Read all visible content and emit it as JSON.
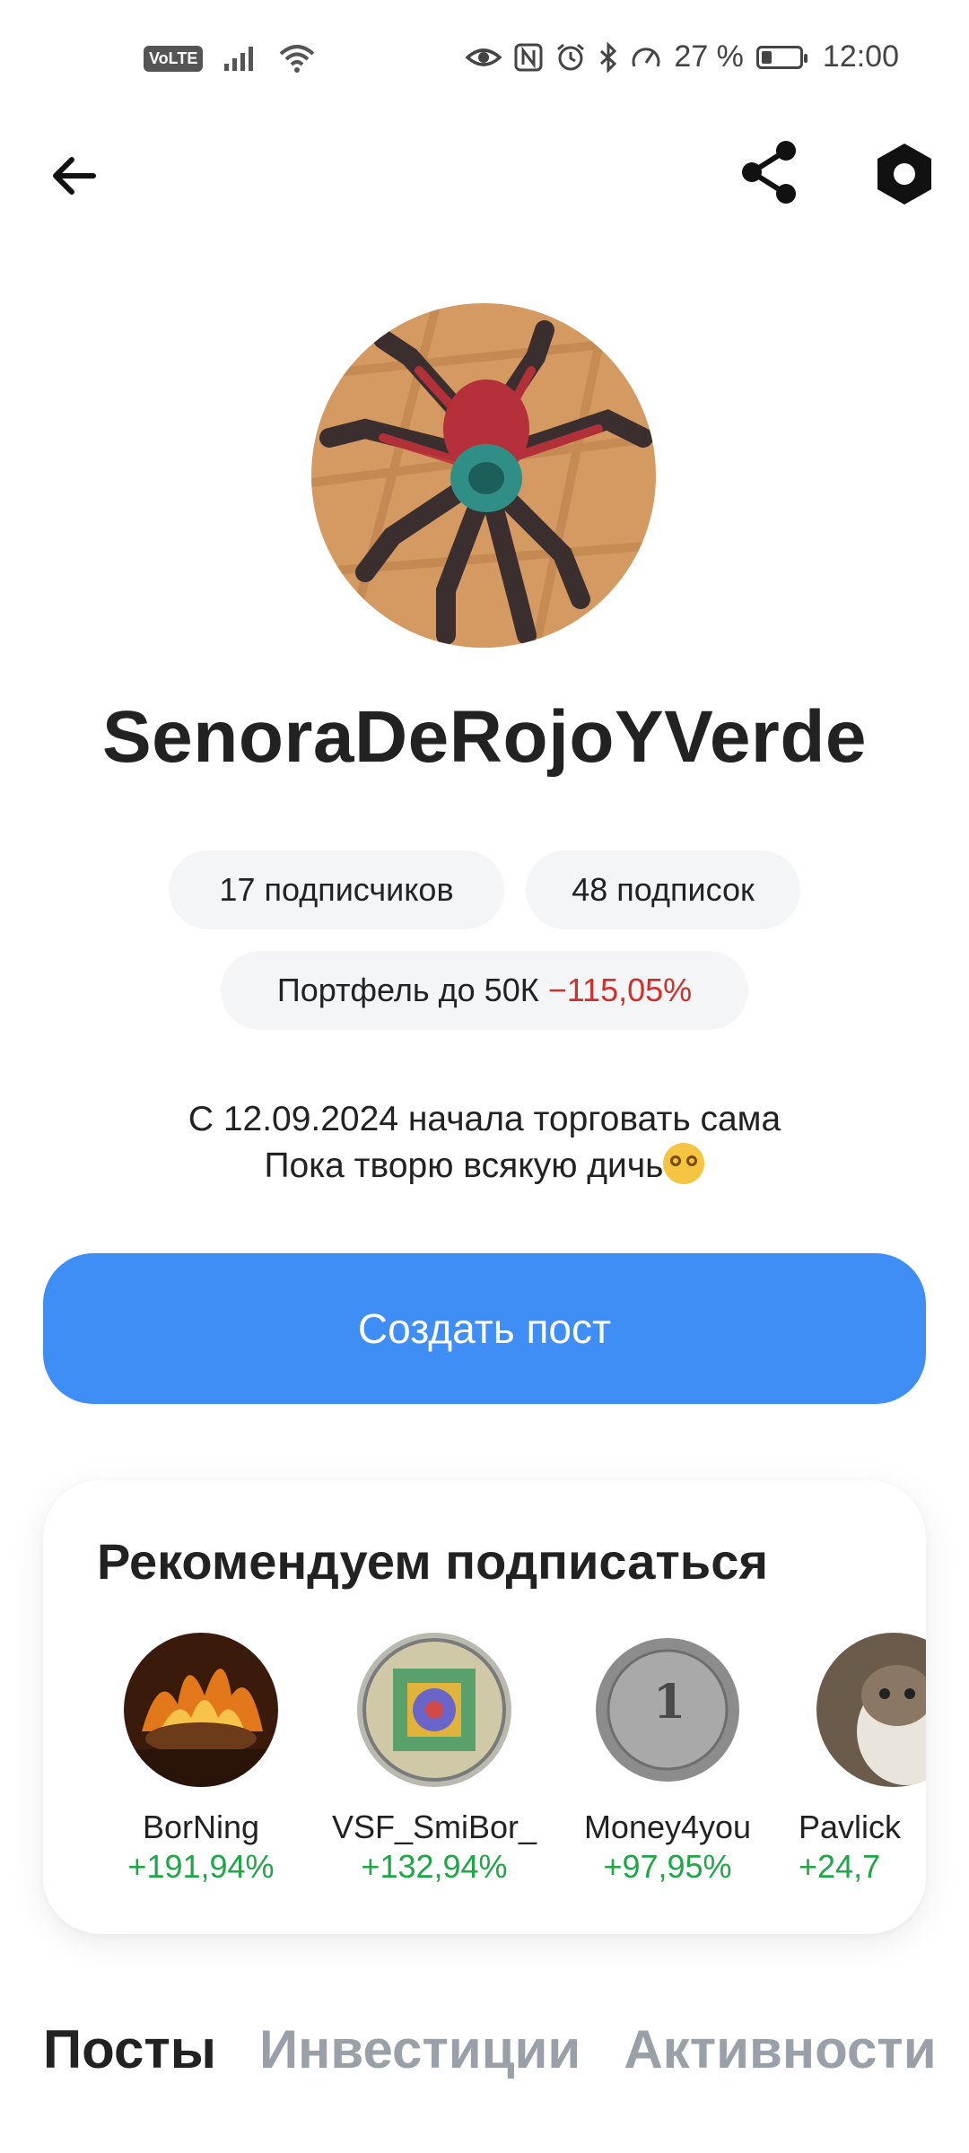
{
  "status_bar": {
    "volte": "VoLTE",
    "battery_percent": "27 %",
    "battery_level": 0.27,
    "time": "12:00"
  },
  "header": {
    "back_icon": "arrow-left-icon",
    "share_icon": "share-icon",
    "settings_icon": "settings-hex-icon"
  },
  "profile": {
    "username": "SenoraDeRojoYVerde",
    "followers": "17 подписчиков",
    "following": "48 подписок",
    "portfolio_label": "Портфель до 50К",
    "portfolio_change": "−115,05%",
    "bio_line1": "С 12.09.2024 начала торговать сама",
    "bio_line2": "Пока творю всякую дичь",
    "create_post": "Создать пост"
  },
  "recommendations": {
    "title": "Рекомендуем подписаться",
    "items": [
      {
        "name": "BorNing",
        "gain": "+191,94%"
      },
      {
        "name": "VSF_SmiBor_",
        "gain": "+132,94%"
      },
      {
        "name": "Money4you",
        "gain": "+97,95%"
      },
      {
        "name": "Pavlick",
        "gain": "+24,7"
      }
    ]
  },
  "tabs": [
    "Посты",
    "Инвестиции",
    "Активности"
  ],
  "colors": {
    "accent": "#3f8ef6",
    "negative": "#d0302b",
    "positive": "#1fa647"
  }
}
